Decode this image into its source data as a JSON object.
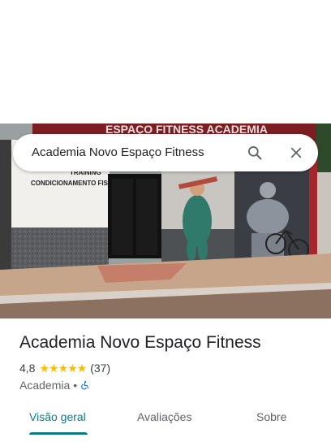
{
  "search": {
    "query": "Academia Novo Espaço Fitness"
  },
  "icons": {
    "search": "search-icon",
    "close": "close-icon",
    "accessibility": "wheelchair-icon"
  },
  "photo": {
    "facade_sign_top": "ESPAÇO FITNESS ACADEMIA",
    "facade_sign_line1": "TRAINING",
    "facade_sign_line2": "CONDICIONAMENTO FISICO"
  },
  "place": {
    "name": "Academia Novo Espaço Fitness",
    "rating": "4,8",
    "stars": "★★★★★",
    "review_count": "(37)",
    "category": "Academia",
    "separator": "•"
  },
  "tabs": [
    {
      "label": "Visão geral",
      "active": true
    },
    {
      "label": "Avaliações",
      "active": false
    },
    {
      "label": "Sobre",
      "active": false
    }
  ],
  "colors": {
    "accent": "#0b7c86",
    "star": "#fbbc04",
    "accessibility": "#1a73e8"
  }
}
